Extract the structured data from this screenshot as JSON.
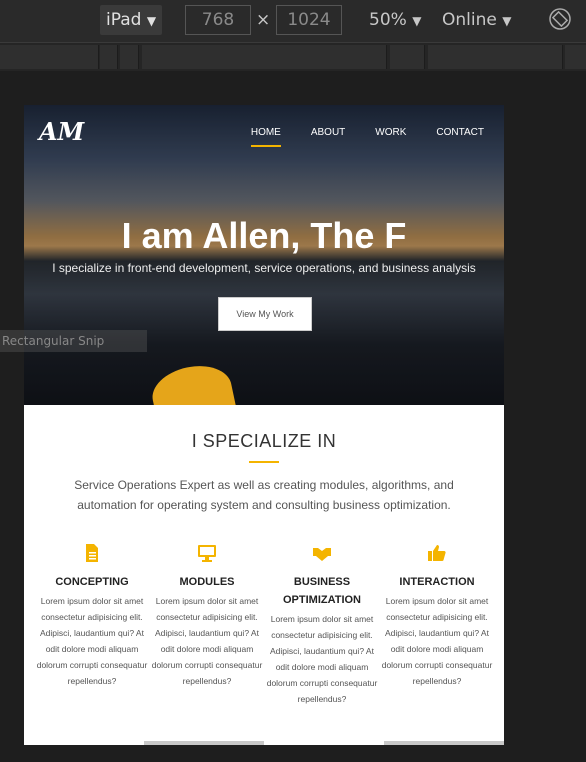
{
  "toolbar": {
    "device": "iPad",
    "width": "768",
    "height": "1024",
    "times": "×",
    "zoom": "50%",
    "network": "Online"
  },
  "overlay": {
    "snip_label": "Rectangular Snip"
  },
  "site": {
    "logo": "AM",
    "nav": [
      "HOME",
      "ABOUT",
      "WORK",
      "CONTACT"
    ],
    "hero_title": "I am Allen, The F",
    "hero_subtitle": "I specialize in front-end development, service operations, and business analysis",
    "hero_button": "View My Work",
    "section_title": "I SPECIALIZE IN",
    "section_description": "Service Operations Expert as well as creating modules, algorithms, and automation for operating system and consulting business optimization.",
    "features": [
      {
        "title": "CONCEPTING",
        "icon": "document-icon",
        "text": "Lorem ipsum dolor sit amet consectetur adipisicing elit. Adipisci, laudantium qui? At odit dolore modi aliquam dolorum corrupti consequatur repellendus?"
      },
      {
        "title": "MODULES",
        "icon": "monitor-icon",
        "text": "Lorem ipsum dolor sit amet consectetur adipisicing elit. Adipisci, laudantium qui? At odit dolore modi aliquam dolorum corrupti consequatur repellendus?"
      },
      {
        "title": "BUSINESS OPTIMIZATION",
        "icon": "handshake-icon",
        "text": "Lorem ipsum dolor sit amet consectetur adipisicing elit. Adipisci, laudantium qui? At odit dolore modi aliquam dolorum corrupti consequatur repellendus?"
      },
      {
        "title": "INTERACTION",
        "icon": "thumbs-up-icon",
        "text": "Lorem ipsum dolor sit amet consectetur adipisicing elit. Adipisci, laudantium qui? At odit dolore modi aliquam dolorum corrupti consequatur repellendus?"
      }
    ],
    "accent_color": "#f4b400"
  }
}
